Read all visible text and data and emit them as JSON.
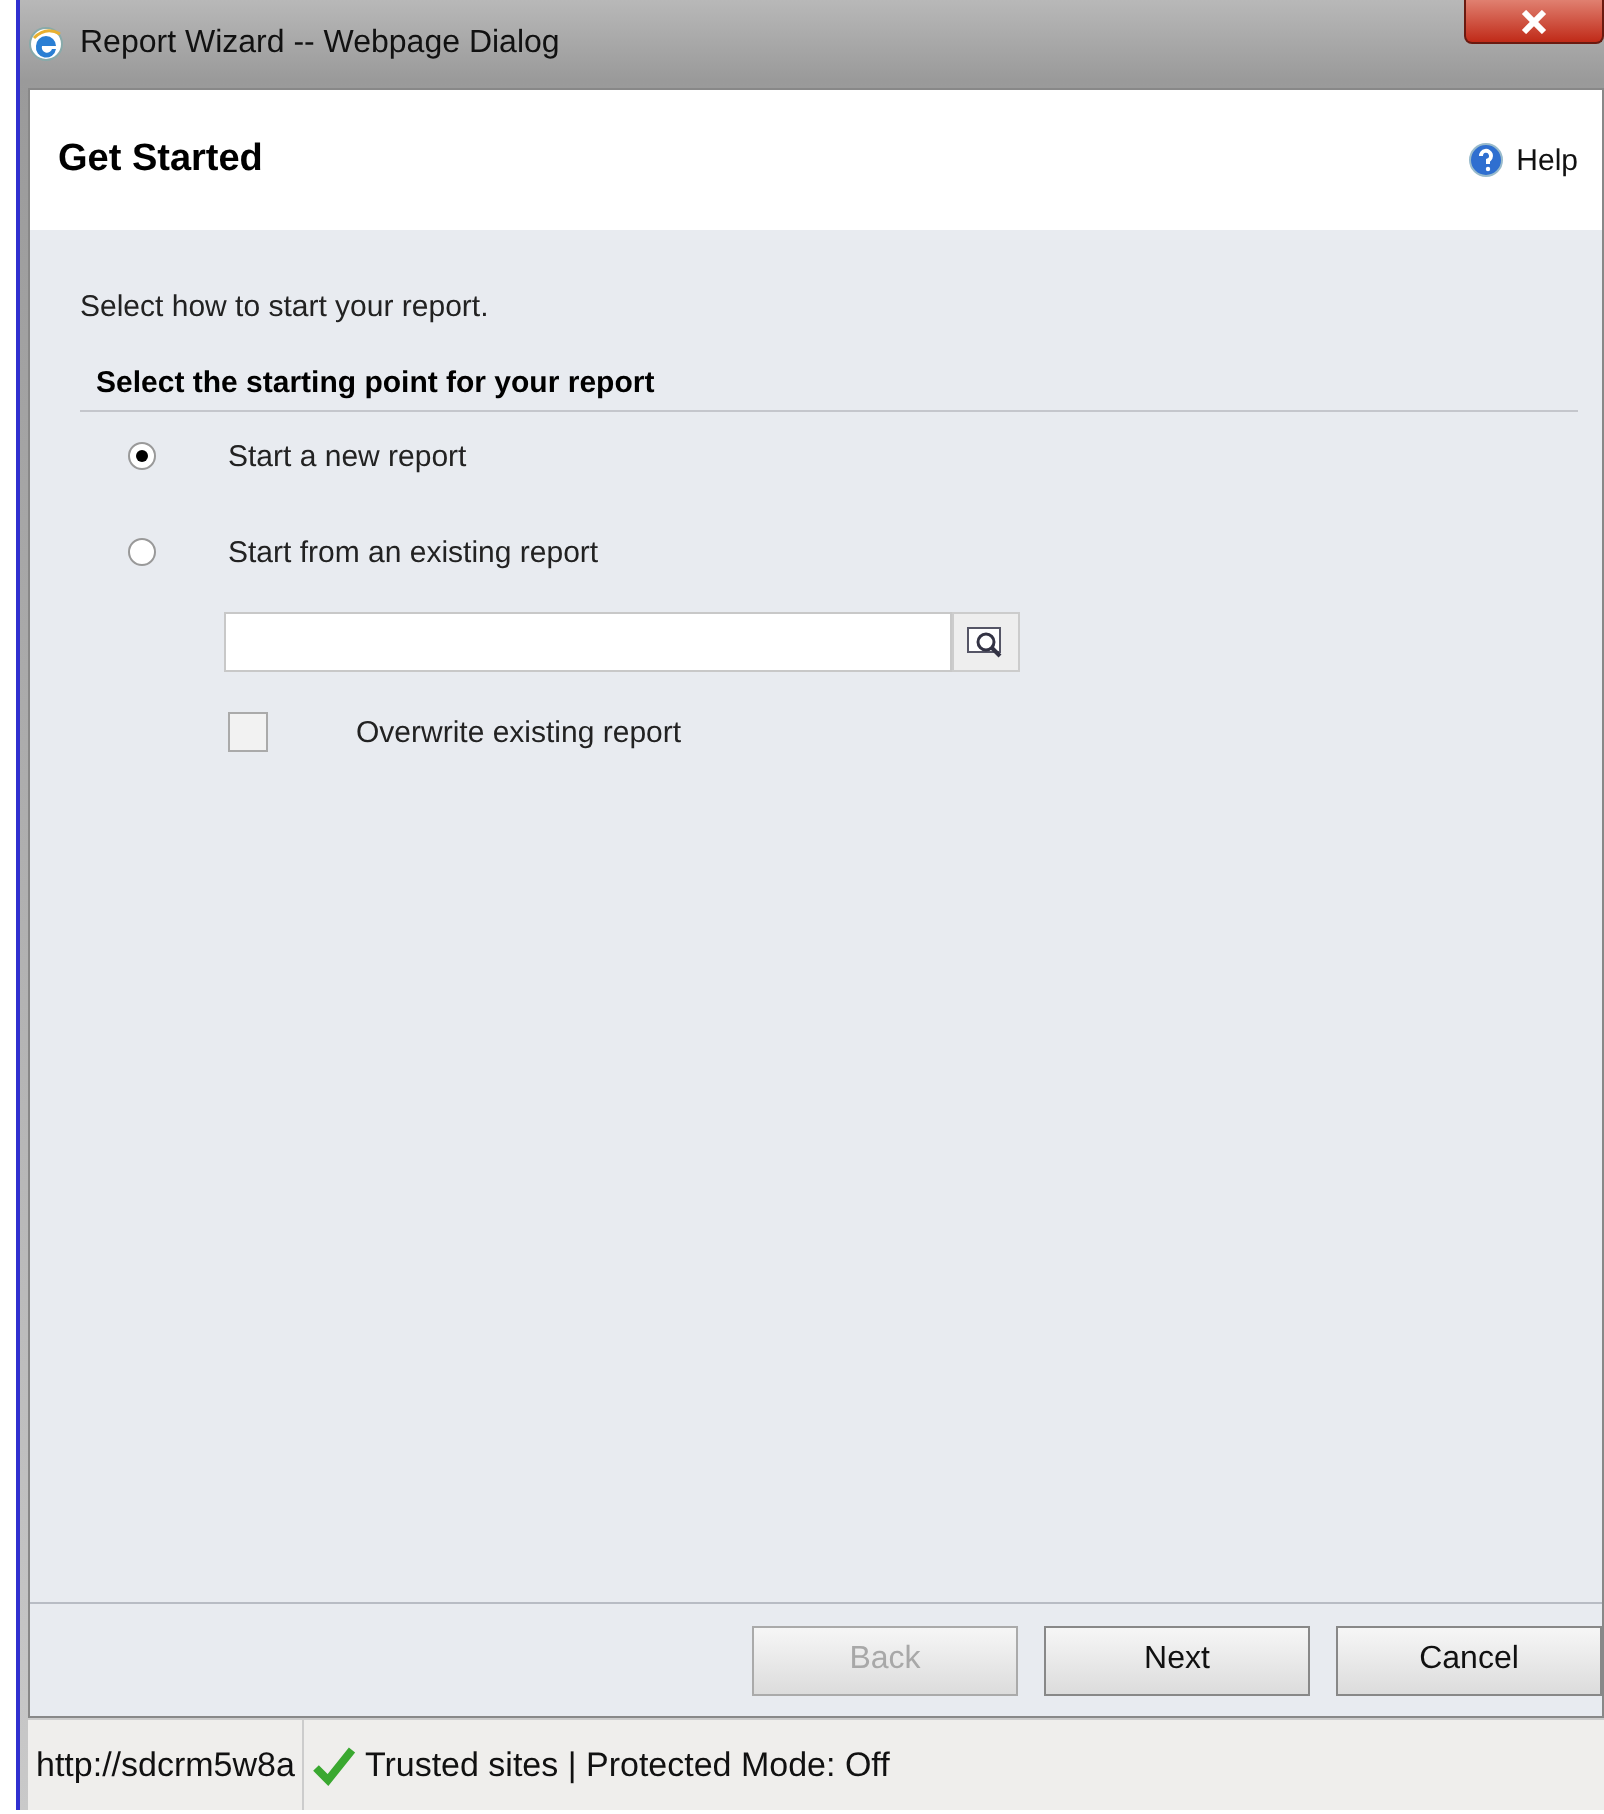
{
  "window": {
    "title": "Report Wizard -- Webpage Dialog"
  },
  "header": {
    "title": "Get Started",
    "help": "Help"
  },
  "intro": "Select how to start your report.",
  "section": {
    "title": "Select the starting point for your report"
  },
  "options": [
    {
      "label": "Start a new report",
      "selected": true
    },
    {
      "label": "Start from an existing report",
      "selected": false
    }
  ],
  "overwrite": {
    "label": "Overwrite existing report",
    "checked": false
  },
  "buttons": [
    {
      "label": "Back",
      "disabled": true
    },
    {
      "label": "Next",
      "disabled": false
    },
    {
      "label": "Cancel",
      "disabled": false
    }
  ],
  "status_bar": {
    "url": "http://sdcrm5w8a",
    "zone": "Trusted sites | Protected Mode: Off"
  }
}
